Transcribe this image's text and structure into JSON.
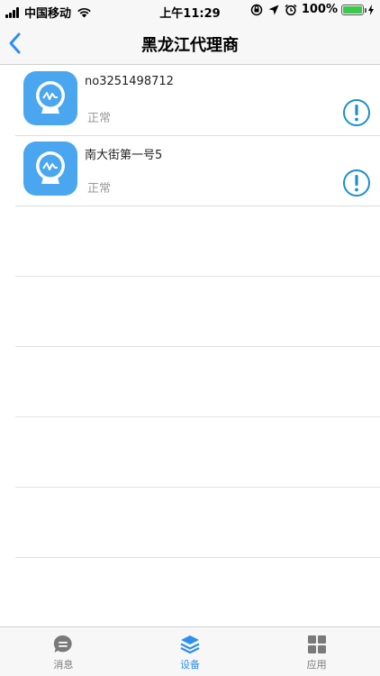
{
  "status_bar": {
    "carrier": "中国移动",
    "time": "上午11:29",
    "battery": "100%",
    "battery_level": 1.0
  },
  "nav": {
    "title": "黑龙江代理商",
    "back_icon": "chevron-left-icon"
  },
  "devices": [
    {
      "name": "no3251498712",
      "status": "正常",
      "icon": "meter-icon",
      "action_icon": "alert-circle-icon"
    },
    {
      "name": "南大街第一号5",
      "status": "正常",
      "icon": "meter-icon",
      "action_icon": "alert-circle-icon"
    }
  ],
  "tabs": [
    {
      "label": "消息",
      "icon": "message-bubble-icon",
      "active": false
    },
    {
      "label": "设备",
      "icon": "layers-icon",
      "active": true
    },
    {
      "label": "应用",
      "icon": "grid-icon",
      "active": false
    }
  ],
  "colors": {
    "accent": "#2e8ff0",
    "icon_bg": "#4aa6ee",
    "alert": "#1a8fd0",
    "battery": "#3cc84b"
  }
}
